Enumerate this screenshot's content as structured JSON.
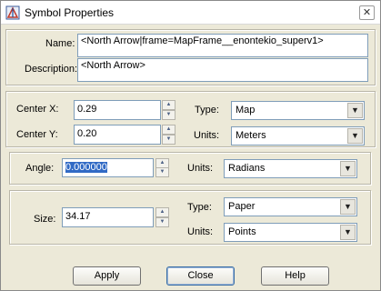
{
  "window": {
    "title": "Symbol Properties",
    "close_glyph": "✕"
  },
  "icons": {
    "app": "symbol-properties-app-icon",
    "close": "close-icon"
  },
  "name_field": {
    "label": "Name:",
    "value": "<North Arrow|frame=MapFrame__enontekio_superv1>"
  },
  "description_field": {
    "label": "Description:",
    "value": "<North Arrow>"
  },
  "position": {
    "center_x": {
      "label": "Center X:",
      "value": "0.29"
    },
    "center_y": {
      "label": "Center Y:",
      "value": "0.20"
    },
    "type": {
      "label": "Type:",
      "value": "Map"
    },
    "units": {
      "label": "Units:",
      "value": "Meters"
    }
  },
  "angle": {
    "label": "Angle:",
    "value": "0.000000",
    "units_label": "Units:",
    "units_value": "Radians"
  },
  "size": {
    "label": "Size:",
    "value": "34.17",
    "type_label": "Type:",
    "type_value": "Paper",
    "units_label": "Units:",
    "units_value": "Points"
  },
  "buttons": {
    "apply": "Apply",
    "close": "Close",
    "help": "Help"
  },
  "colors": {
    "selection": "#316ac5",
    "dialog_bg": "#ece9d8",
    "field_border": "#7f9db9"
  }
}
